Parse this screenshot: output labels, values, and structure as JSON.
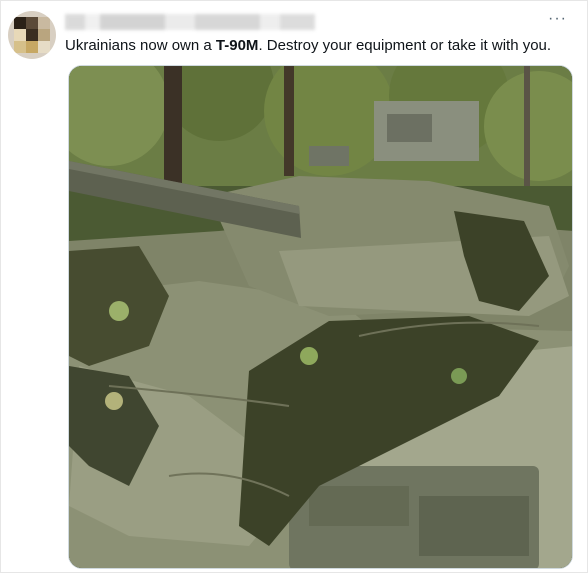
{
  "tweet": {
    "text_pre": "Ukrainians now own a ",
    "text_bold": "T-90M",
    "text_post": ". Destroy your equipment or take it with you.",
    "more_glyph": "···"
  },
  "media": {
    "kind": "photo",
    "subject": "camouflaged tank in forest",
    "colors": {
      "foliage": "#5a6b3c",
      "tarp": "#8f9478",
      "camo_net": "#3c4228",
      "hull": "#6f7560",
      "gun": "#5d6150"
    }
  }
}
